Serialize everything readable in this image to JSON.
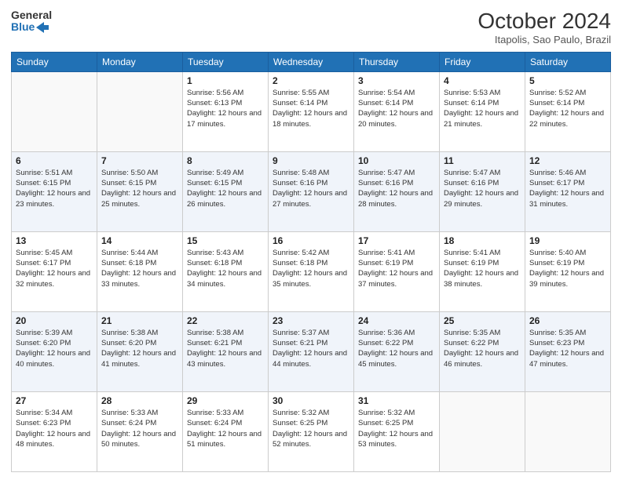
{
  "header": {
    "logo_line1": "General",
    "logo_line2": "Blue",
    "month_year": "October 2024",
    "location": "Itapolis, Sao Paulo, Brazil"
  },
  "days_of_week": [
    "Sunday",
    "Monday",
    "Tuesday",
    "Wednesday",
    "Thursday",
    "Friday",
    "Saturday"
  ],
  "weeks": [
    [
      {
        "day": "",
        "info": ""
      },
      {
        "day": "",
        "info": ""
      },
      {
        "day": "1",
        "info": "Sunrise: 5:56 AM\nSunset: 6:13 PM\nDaylight: 12 hours and 17 minutes."
      },
      {
        "day": "2",
        "info": "Sunrise: 5:55 AM\nSunset: 6:14 PM\nDaylight: 12 hours and 18 minutes."
      },
      {
        "day": "3",
        "info": "Sunrise: 5:54 AM\nSunset: 6:14 PM\nDaylight: 12 hours and 20 minutes."
      },
      {
        "day": "4",
        "info": "Sunrise: 5:53 AM\nSunset: 6:14 PM\nDaylight: 12 hours and 21 minutes."
      },
      {
        "day": "5",
        "info": "Sunrise: 5:52 AM\nSunset: 6:14 PM\nDaylight: 12 hours and 22 minutes."
      }
    ],
    [
      {
        "day": "6",
        "info": "Sunrise: 5:51 AM\nSunset: 6:15 PM\nDaylight: 12 hours and 23 minutes."
      },
      {
        "day": "7",
        "info": "Sunrise: 5:50 AM\nSunset: 6:15 PM\nDaylight: 12 hours and 25 minutes."
      },
      {
        "day": "8",
        "info": "Sunrise: 5:49 AM\nSunset: 6:15 PM\nDaylight: 12 hours and 26 minutes."
      },
      {
        "day": "9",
        "info": "Sunrise: 5:48 AM\nSunset: 6:16 PM\nDaylight: 12 hours and 27 minutes."
      },
      {
        "day": "10",
        "info": "Sunrise: 5:47 AM\nSunset: 6:16 PM\nDaylight: 12 hours and 28 minutes."
      },
      {
        "day": "11",
        "info": "Sunrise: 5:47 AM\nSunset: 6:16 PM\nDaylight: 12 hours and 29 minutes."
      },
      {
        "day": "12",
        "info": "Sunrise: 5:46 AM\nSunset: 6:17 PM\nDaylight: 12 hours and 31 minutes."
      }
    ],
    [
      {
        "day": "13",
        "info": "Sunrise: 5:45 AM\nSunset: 6:17 PM\nDaylight: 12 hours and 32 minutes."
      },
      {
        "day": "14",
        "info": "Sunrise: 5:44 AM\nSunset: 6:18 PM\nDaylight: 12 hours and 33 minutes."
      },
      {
        "day": "15",
        "info": "Sunrise: 5:43 AM\nSunset: 6:18 PM\nDaylight: 12 hours and 34 minutes."
      },
      {
        "day": "16",
        "info": "Sunrise: 5:42 AM\nSunset: 6:18 PM\nDaylight: 12 hours and 35 minutes."
      },
      {
        "day": "17",
        "info": "Sunrise: 5:41 AM\nSunset: 6:19 PM\nDaylight: 12 hours and 37 minutes."
      },
      {
        "day": "18",
        "info": "Sunrise: 5:41 AM\nSunset: 6:19 PM\nDaylight: 12 hours and 38 minutes."
      },
      {
        "day": "19",
        "info": "Sunrise: 5:40 AM\nSunset: 6:19 PM\nDaylight: 12 hours and 39 minutes."
      }
    ],
    [
      {
        "day": "20",
        "info": "Sunrise: 5:39 AM\nSunset: 6:20 PM\nDaylight: 12 hours and 40 minutes."
      },
      {
        "day": "21",
        "info": "Sunrise: 5:38 AM\nSunset: 6:20 PM\nDaylight: 12 hours and 41 minutes."
      },
      {
        "day": "22",
        "info": "Sunrise: 5:38 AM\nSunset: 6:21 PM\nDaylight: 12 hours and 43 minutes."
      },
      {
        "day": "23",
        "info": "Sunrise: 5:37 AM\nSunset: 6:21 PM\nDaylight: 12 hours and 44 minutes."
      },
      {
        "day": "24",
        "info": "Sunrise: 5:36 AM\nSunset: 6:22 PM\nDaylight: 12 hours and 45 minutes."
      },
      {
        "day": "25",
        "info": "Sunrise: 5:35 AM\nSunset: 6:22 PM\nDaylight: 12 hours and 46 minutes."
      },
      {
        "day": "26",
        "info": "Sunrise: 5:35 AM\nSunset: 6:23 PM\nDaylight: 12 hours and 47 minutes."
      }
    ],
    [
      {
        "day": "27",
        "info": "Sunrise: 5:34 AM\nSunset: 6:23 PM\nDaylight: 12 hours and 48 minutes."
      },
      {
        "day": "28",
        "info": "Sunrise: 5:33 AM\nSunset: 6:24 PM\nDaylight: 12 hours and 50 minutes."
      },
      {
        "day": "29",
        "info": "Sunrise: 5:33 AM\nSunset: 6:24 PM\nDaylight: 12 hours and 51 minutes."
      },
      {
        "day": "30",
        "info": "Sunrise: 5:32 AM\nSunset: 6:25 PM\nDaylight: 12 hours and 52 minutes."
      },
      {
        "day": "31",
        "info": "Sunrise: 5:32 AM\nSunset: 6:25 PM\nDaylight: 12 hours and 53 minutes."
      },
      {
        "day": "",
        "info": ""
      },
      {
        "day": "",
        "info": ""
      }
    ]
  ]
}
